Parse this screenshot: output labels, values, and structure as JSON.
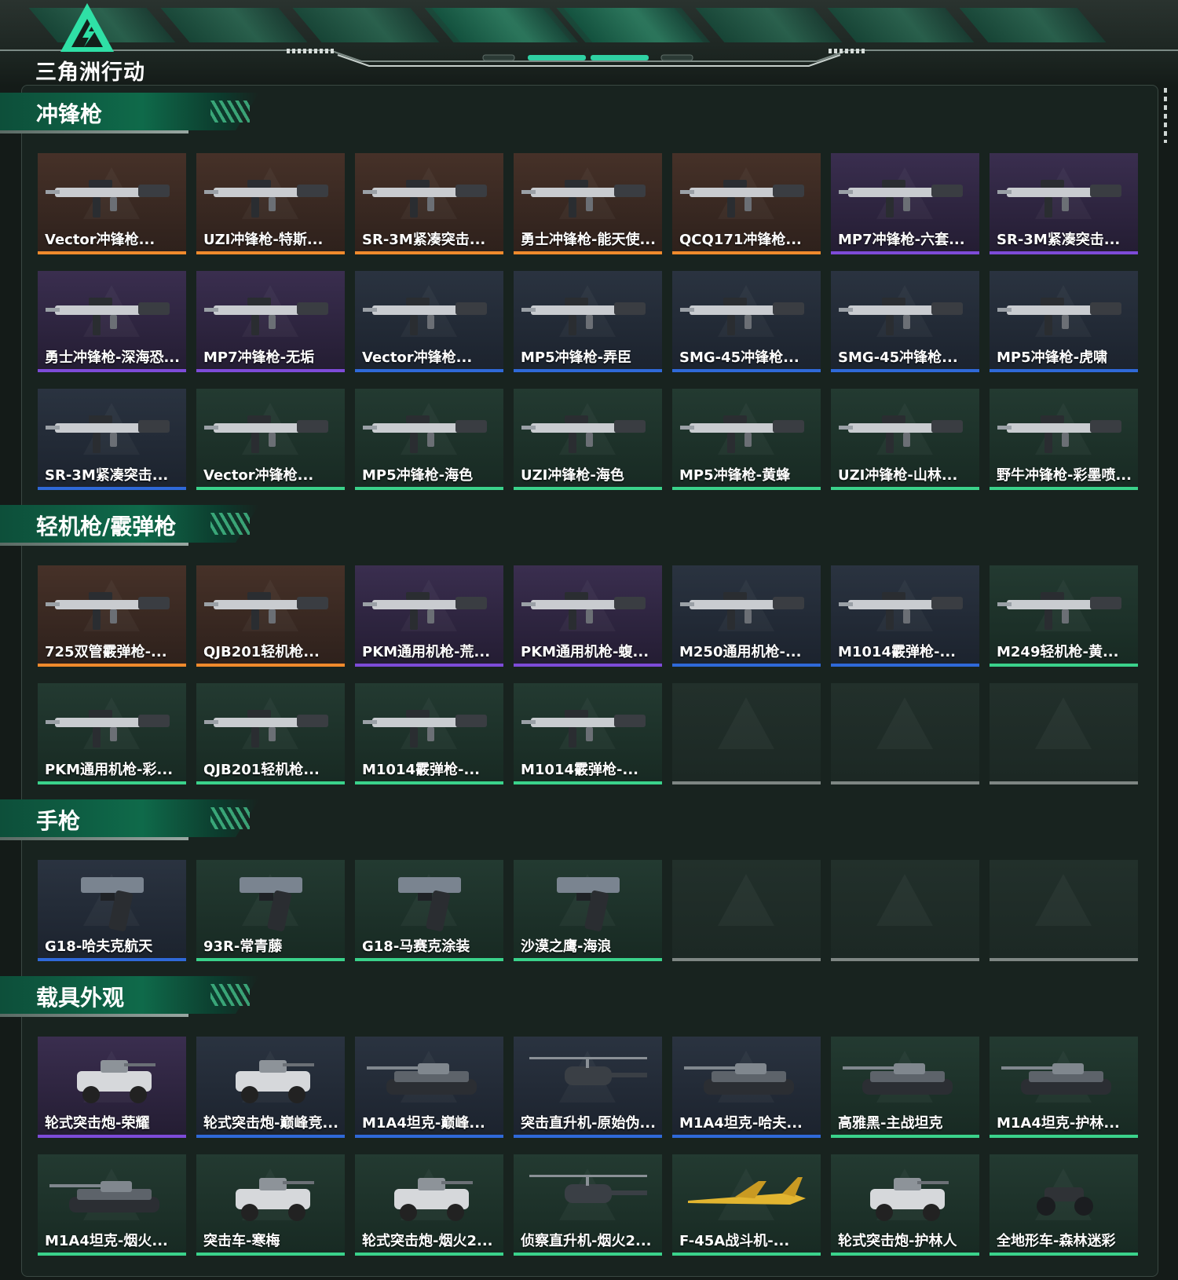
{
  "app": {
    "logo_text": "三角洲行动"
  },
  "colors": {
    "accent": "#3ad28b",
    "orange_rarity": "#f08a2c",
    "purple_rarity": "#7d4bd8",
    "blue_rarity": "#2f69d8",
    "green_rarity": "#3ad28b",
    "empty_slot": "#7e8683"
  },
  "sections": [
    {
      "title": "冲锋枪",
      "items": [
        {
          "name": "Vector冲锋枪...",
          "rarity": "orange",
          "icon": "gun-icon"
        },
        {
          "name": "UZI冲锋枪-特斯...",
          "rarity": "orange",
          "icon": "gun-icon"
        },
        {
          "name": "SR-3M紧凑突击...",
          "rarity": "orange",
          "icon": "gun-icon"
        },
        {
          "name": "勇士冲锋枪-能天使...",
          "rarity": "orange",
          "icon": "gun-icon"
        },
        {
          "name": "QCQ171冲锋枪...",
          "rarity": "orange",
          "icon": "gun-icon"
        },
        {
          "name": "MP7冲锋枪-六套...",
          "rarity": "purple",
          "icon": "gun-icon"
        },
        {
          "name": "SR-3M紧凑突击...",
          "rarity": "purple",
          "icon": "gun-icon"
        },
        {
          "name": "勇士冲锋枪-深海恐...",
          "rarity": "purple",
          "icon": "gun-icon"
        },
        {
          "name": "MP7冲锋枪-无垢",
          "rarity": "purple",
          "icon": "gun-icon"
        },
        {
          "name": "Vector冲锋枪...",
          "rarity": "blue",
          "icon": "gun-icon"
        },
        {
          "name": "MP5冲锋枪-弄臣",
          "rarity": "blue",
          "icon": "gun-icon"
        },
        {
          "name": "SMG-45冲锋枪...",
          "rarity": "blue",
          "icon": "gun-icon"
        },
        {
          "name": "SMG-45冲锋枪...",
          "rarity": "blue",
          "icon": "gun-icon"
        },
        {
          "name": "MP5冲锋枪-虎啸",
          "rarity": "blue",
          "icon": "gun-icon"
        },
        {
          "name": "SR-3M紧凑突击...",
          "rarity": "blue",
          "icon": "gun-icon"
        },
        {
          "name": "Vector冲锋枪...",
          "rarity": "green",
          "icon": "gun-icon"
        },
        {
          "name": "MP5冲锋枪-海色",
          "rarity": "green",
          "icon": "gun-icon"
        },
        {
          "name": "UZI冲锋枪-海色",
          "rarity": "green",
          "icon": "gun-icon"
        },
        {
          "name": "MP5冲锋枪-黄蜂",
          "rarity": "green",
          "icon": "gun-icon"
        },
        {
          "name": "UZI冲锋枪-山林...",
          "rarity": "green",
          "icon": "gun-icon"
        },
        {
          "name": "野牛冲锋枪-彩墨喷...",
          "rarity": "green",
          "icon": "gun-icon"
        }
      ]
    },
    {
      "title": "轻机枪/霰弹枪",
      "items": [
        {
          "name": "725双管霰弹枪-...",
          "rarity": "orange",
          "icon": "gun-icon"
        },
        {
          "name": "QJB201轻机枪...",
          "rarity": "orange",
          "icon": "gun-icon"
        },
        {
          "name": "PKM通用机枪-荒...",
          "rarity": "purple",
          "icon": "gun-icon"
        },
        {
          "name": "PKM通用机枪-蝮...",
          "rarity": "purple",
          "icon": "gun-icon"
        },
        {
          "name": "M250通用机枪-...",
          "rarity": "blue",
          "icon": "gun-icon"
        },
        {
          "name": "M1014霰弹枪-...",
          "rarity": "blue",
          "icon": "gun-icon"
        },
        {
          "name": "M249轻机枪-黄...",
          "rarity": "green",
          "icon": "gun-icon"
        },
        {
          "name": "PKM通用机枪-彩...",
          "rarity": "green",
          "icon": "gun-icon"
        },
        {
          "name": "QJB201轻机枪...",
          "rarity": "green",
          "icon": "gun-icon"
        },
        {
          "name": "M1014霰弹枪-...",
          "rarity": "green",
          "icon": "gun-icon"
        },
        {
          "name": "M1014霰弹枪-...",
          "rarity": "green",
          "icon": "gun-icon"
        },
        {
          "name": "",
          "rarity": "empty",
          "icon": "empty-slot-icon"
        },
        {
          "name": "",
          "rarity": "empty",
          "icon": "empty-slot-icon"
        },
        {
          "name": "",
          "rarity": "empty",
          "icon": "empty-slot-icon"
        }
      ]
    },
    {
      "title": "手枪",
      "items": [
        {
          "name": "G18-哈夫克航天",
          "rarity": "blue",
          "icon": "pistol-icon"
        },
        {
          "name": "93R-常青藤",
          "rarity": "green",
          "icon": "pistol-icon"
        },
        {
          "name": "G18-马赛克涂装",
          "rarity": "green",
          "icon": "pistol-icon"
        },
        {
          "name": "沙漠之鹰-海浪",
          "rarity": "green",
          "icon": "pistol-icon"
        },
        {
          "name": "",
          "rarity": "empty",
          "icon": "empty-slot-icon"
        },
        {
          "name": "",
          "rarity": "empty",
          "icon": "empty-slot-icon"
        },
        {
          "name": "",
          "rarity": "empty",
          "icon": "empty-slot-icon"
        }
      ]
    },
    {
      "title": "载具外观",
      "items": [
        {
          "name": "轮式突击炮-荣耀",
          "rarity": "purple",
          "icon": "vehicle-icon"
        },
        {
          "name": "轮式突击炮-巅峰竞...",
          "rarity": "blue",
          "icon": "vehicle-icon"
        },
        {
          "name": "M1A4坦克-巅峰...",
          "rarity": "blue",
          "icon": "tank-icon"
        },
        {
          "name": "突击直升机-原始伪...",
          "rarity": "blue",
          "icon": "helicopter-icon"
        },
        {
          "name": "M1A4坦克-哈夫...",
          "rarity": "blue",
          "icon": "tank-icon"
        },
        {
          "name": "高雅黑-主战坦克",
          "rarity": "green",
          "icon": "tank-icon"
        },
        {
          "name": "M1A4坦克-护林...",
          "rarity": "green",
          "icon": "tank-icon"
        },
        {
          "name": "M1A4坦克-烟火...",
          "rarity": "green",
          "icon": "tank-icon"
        },
        {
          "name": "突击车-寒梅",
          "rarity": "green",
          "icon": "vehicle-icon"
        },
        {
          "name": "轮式突击炮-烟火2...",
          "rarity": "green",
          "icon": "vehicle-icon"
        },
        {
          "name": "侦察直升机-烟火2...",
          "rarity": "green",
          "icon": "helicopter-icon"
        },
        {
          "name": "F-45A战斗机-...",
          "rarity": "green",
          "icon": "jet-icon"
        },
        {
          "name": "轮式突击炮-护林人",
          "rarity": "green",
          "icon": "vehicle-icon"
        },
        {
          "name": "全地形车-森林迷彩",
          "rarity": "green",
          "icon": "atv-icon"
        }
      ]
    }
  ]
}
